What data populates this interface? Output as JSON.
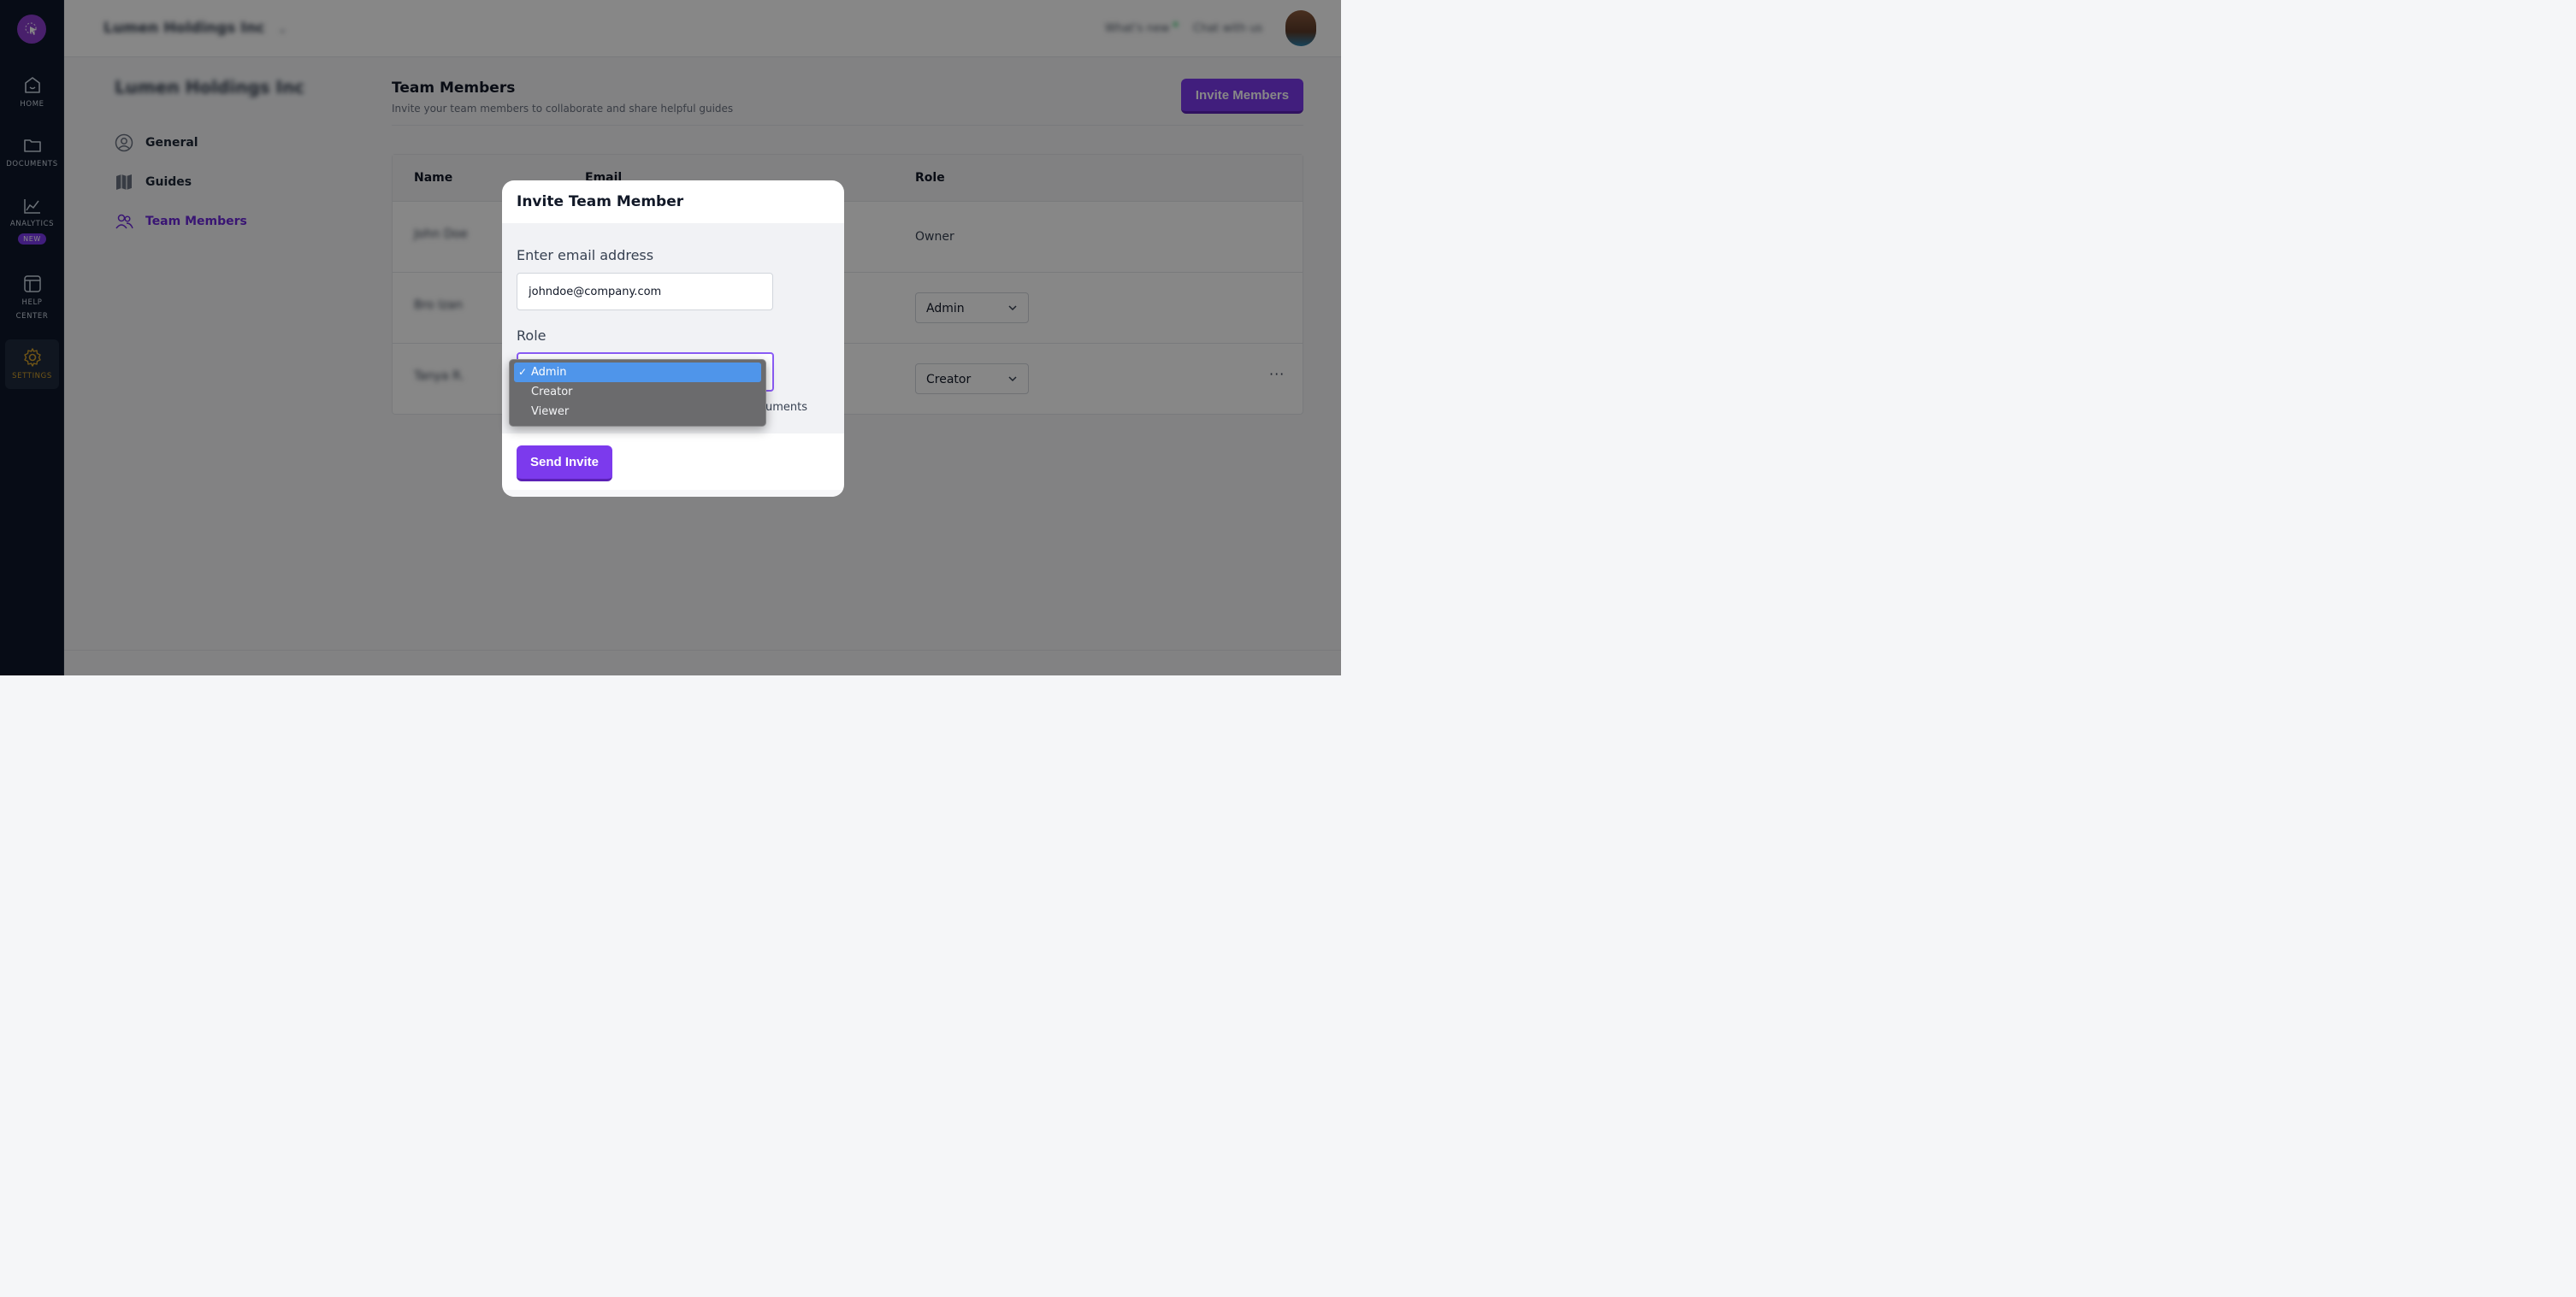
{
  "rail": {
    "items": [
      {
        "label": "HOME",
        "icon": "home-icon"
      },
      {
        "label": "DOCUMENTS",
        "icon": "folder-icon"
      },
      {
        "label": "ANALYTICS",
        "icon": "analytics-icon",
        "badge": "NEW"
      },
      {
        "label_line1": "HELP",
        "label_line2": "CENTER",
        "icon": "help-center-icon"
      },
      {
        "label": "SETTINGS",
        "icon": "gear-icon"
      }
    ]
  },
  "topbar": {
    "workspace_name": "Lumen Holdings Inc",
    "whats_new": "What's new",
    "chat": "Chat with us"
  },
  "settings_nav": {
    "org_name": "Lumen Holdings Inc",
    "items": [
      {
        "label": "General",
        "icon": "user-circle-icon"
      },
      {
        "label": "Guides",
        "icon": "map-icon"
      },
      {
        "label": "Team Members",
        "icon": "team-icon"
      }
    ]
  },
  "main": {
    "title": "Team Members",
    "subtitle": "Invite your team members to collaborate and share helpful guides",
    "invite_button": "Invite Members",
    "table": {
      "headers": {
        "name": "Name",
        "email": "Email",
        "role": "Role"
      },
      "rows": [
        {
          "name": "John Doe",
          "role": "Owner"
        },
        {
          "name": "Bro Izan",
          "role": "Admin"
        },
        {
          "name": "Tanya R.",
          "role": "Creator",
          "more": "···"
        }
      ]
    }
  },
  "modal": {
    "title": "Invite Team Member",
    "email_label": "Enter email address",
    "email_value": "johndoe@company.com",
    "role_label": "Role",
    "helper_visible": "uments",
    "send_button": "Send Invite"
  },
  "dropdown": {
    "options": [
      {
        "label": "Admin",
        "selected": true
      },
      {
        "label": "Creator",
        "selected": false
      },
      {
        "label": "Viewer",
        "selected": false
      }
    ],
    "check_glyph": "✓"
  },
  "colors": {
    "brand": "#7c3aed",
    "rail_bg": "#0f172a",
    "active_settings": "#d4a02a",
    "selected_option": "#4f95ea"
  }
}
